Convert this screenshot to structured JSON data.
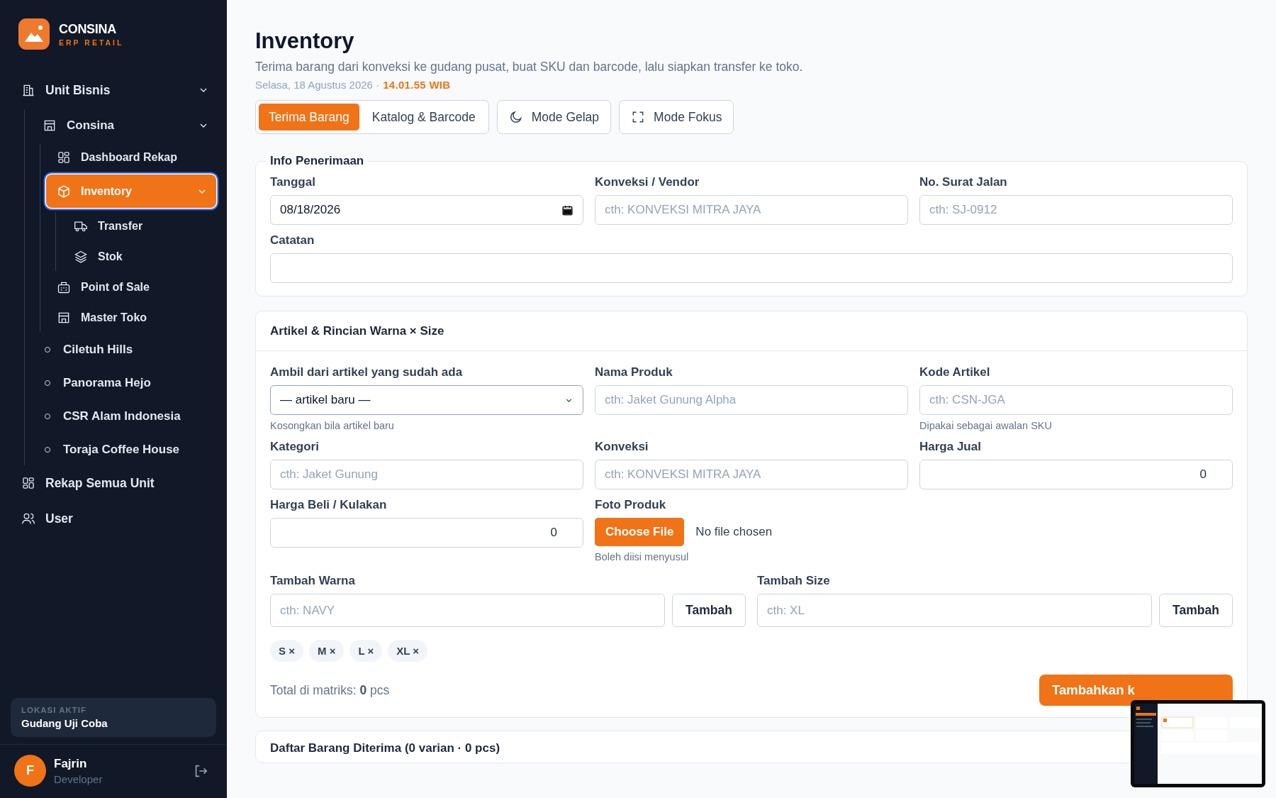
{
  "brand": {
    "name": "CONSINA",
    "tagline": "ERP RETAIL"
  },
  "sidebar": {
    "items": [
      {
        "label": "Unit Bisnis",
        "kind": "link",
        "selected": false,
        "expanded": true,
        "children": [
          {
            "label": "Consina",
            "kind": "link",
            "selected": false,
            "expanded": true,
            "children": [
              {
                "label": "Dashboard Rekap",
                "kind": "link",
                "selected": false
              },
              {
                "label": "Inventory",
                "kind": "link",
                "selected": true,
                "expanded": true,
                "children": [
                  {
                    "label": "Transfer",
                    "kind": "link",
                    "selected": false
                  },
                  {
                    "label": "Stok",
                    "kind": "link",
                    "selected": false
                  }
                ]
              },
              {
                "label": "Point of Sale",
                "kind": "link",
                "selected": false
              },
              {
                "label": "Master Toko",
                "kind": "link",
                "selected": false
              }
            ]
          },
          {
            "label": "Ciletuh Hills",
            "kind": "unit",
            "selected": false
          },
          {
            "label": "Panorama Hejo",
            "kind": "unit",
            "selected": false
          },
          {
            "label": "CSR Alam Indonesia",
            "kind": "unit",
            "selected": false
          },
          {
            "label": "Toraja Coffee House",
            "kind": "unit",
            "selected": false
          }
        ]
      },
      {
        "label": "Rekap Semua Unit",
        "kind": "link",
        "selected": false
      },
      {
        "label": "User",
        "kind": "link",
        "selected": false
      }
    ],
    "location": {
      "label": "LOKASI AKTIF",
      "value": "Gudang Uji Coba"
    },
    "user": {
      "initial": "F",
      "name": "Fajrin",
      "role": "Developer"
    }
  },
  "header": {
    "title": "Inventory",
    "subtitle": "Terima barang dari konveksi ke gudang pusat, buat SKU dan barcode, lalu siapkan transfer ke toko.",
    "date": "Selasa, 18 Agustus 2026 ·",
    "time": "14.01.55 WIB"
  },
  "tabs": [
    {
      "label": "Terima Barang",
      "selected": true
    },
    {
      "label": "Katalog & Barcode",
      "selected": false
    }
  ],
  "mode_buttons": [
    {
      "label": "Mode Gelap"
    },
    {
      "label": "Mode Fokus"
    }
  ],
  "info_card": {
    "title": "Info Penerimaan",
    "fields": [
      {
        "label": "Tanggal",
        "kind": "date",
        "value": "08/18/2026"
      },
      {
        "label": "Konveksi / Vendor",
        "kind": "text",
        "placeholder": "cth: KONVEKSI MITRA JAYA"
      },
      {
        "label": "No. Surat Jalan",
        "kind": "text",
        "placeholder": "cth: SJ-0912"
      },
      {
        "label": "Catatan",
        "kind": "note"
      }
    ]
  },
  "article_card": {
    "title": "Artikel & Rincian Warna × Size",
    "fields": [
      {
        "label": "Ambil dari artikel yang sudah ada",
        "kind": "select",
        "value": "— artikel baru —",
        "hint": "Kosongkan bila artikel baru"
      },
      {
        "label": "Nama Produk",
        "kind": "text",
        "placeholder": "cth: Jaket Gunung Alpha"
      },
      {
        "label": "Kode Artikel",
        "kind": "text",
        "placeholder": "cth: CSN-JGA",
        "hint": "Dipakai sebagai awalan SKU"
      },
      {
        "label": "Kategori",
        "kind": "text",
        "placeholder": "cth: Jaket Gunung"
      },
      {
        "label": "Konveksi",
        "kind": "text",
        "placeholder": "cth: KONVEKSI MITRA JAYA"
      },
      {
        "label": "Harga Jual",
        "kind": "number",
        "value": "0"
      },
      {
        "label": "Harga Beli / Kulakan",
        "kind": "number",
        "value": "0"
      },
      {
        "label": "Foto Produk",
        "kind": "file",
        "button": "Choose File",
        "value": "No file chosen",
        "hint": "Boleh diisi menyusul"
      }
    ],
    "adders": [
      {
        "label": "Tambah Warna",
        "placeholder": "cth: NAVY",
        "button": "Tambah"
      },
      {
        "label": "Tambah Size",
        "placeholder": "cth: XL",
        "button": "Tambah"
      }
    ],
    "chips": [
      {
        "label": "S",
        "remove": "×"
      },
      {
        "label": "M",
        "remove": "×"
      },
      {
        "label": "L",
        "remove": "×"
      },
      {
        "label": "XL",
        "remove": "×"
      }
    ],
    "total": "Total di matriks: **0** pcs",
    "submit_button": "Tambahkan k"
  },
  "received_card": {
    "title": "Daftar Barang Diterima (0 varian · 0 pcs)"
  }
}
